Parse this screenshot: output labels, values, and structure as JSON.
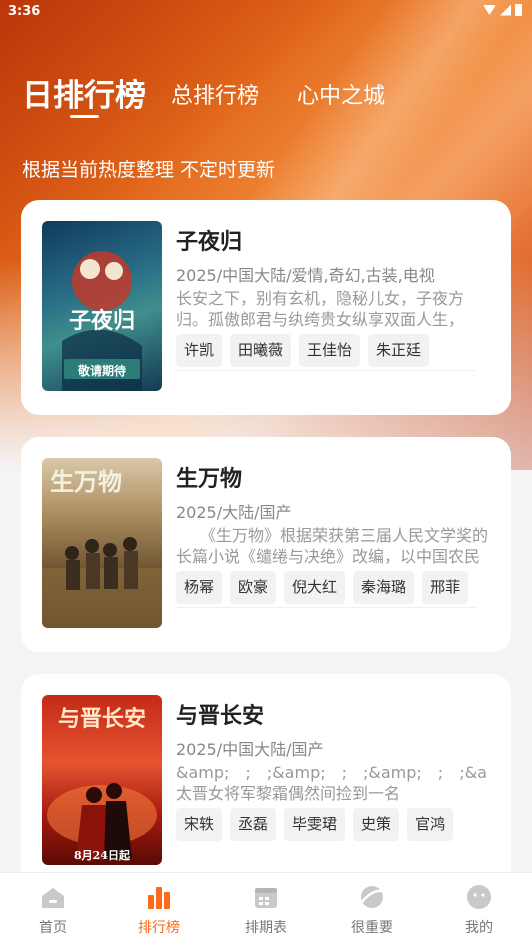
{
  "status_bar": {
    "time": "3:36"
  },
  "tabs": [
    {
      "label": "日排行榜",
      "active": true
    },
    {
      "label": "总排行榜",
      "active": false
    },
    {
      "label": "心中之城",
      "active": false
    }
  ],
  "subtitle": "根据当前热度整理 不定时更新",
  "cards": [
    {
      "title": "子夜归",
      "meta": "2025/中国大陆/爱情,奇幻,古装,电视",
      "desc": "长安之下，别有玄机，隐秘儿女，子夜方归。孤傲郎君与纨绔贵女纵享双面人生，",
      "cast": [
        "许凯",
        "田曦薇",
        "王佳怡",
        "朱正廷"
      ],
      "poster": {
        "caption": "子夜归",
        "tag": "敬请期待",
        "colors": [
          "#1d4f74",
          "#2f7a88",
          "#1a3c5a"
        ]
      }
    },
    {
      "title": "生万物",
      "meta": "2025/大陆/国产",
      "desc": "　　《生万物》根据荣获第三届人民文学奖的长篇小说《缱绻与决绝》改编，以中国农民",
      "cast": [
        "杨幂",
        "欧豪",
        "倪大红",
        "秦海璐",
        "邢菲"
      ],
      "poster": {
        "caption": "生万物",
        "tag": "",
        "colors": [
          "#6b5234",
          "#9a7a4e",
          "#3d2e1c"
        ]
      }
    },
    {
      "title": "与晋长安",
      "meta": "2025/中国大陆/国产",
      "desc": "&amp;　;　;&amp;　;　;&amp;　;　;&amp;　;　;太晋女将军黎霜偶然间捡到一名",
      "cast": [
        "宋轶",
        "丞磊",
        "毕雯珺",
        "史策",
        "官鸿"
      ],
      "poster": {
        "caption": "与晋长安",
        "tag": "8月24日起",
        "colors": [
          "#b51f12",
          "#e0472a",
          "#6e0d06"
        ]
      }
    }
  ],
  "tabbar": [
    {
      "label": "首页",
      "icon": "home-icon",
      "active": false
    },
    {
      "label": "排行榜",
      "icon": "ranking-icon",
      "active": true
    },
    {
      "label": "排期表",
      "icon": "calendar-icon",
      "active": false
    },
    {
      "label": "很重要",
      "icon": "star-planet-icon",
      "active": false
    },
    {
      "label": "我的",
      "icon": "profile-icon",
      "active": false
    }
  ],
  "colors": {
    "accent": "#ff6a1a",
    "hero_start": "#c8410d",
    "hero_mid": "#f08a3a"
  }
}
